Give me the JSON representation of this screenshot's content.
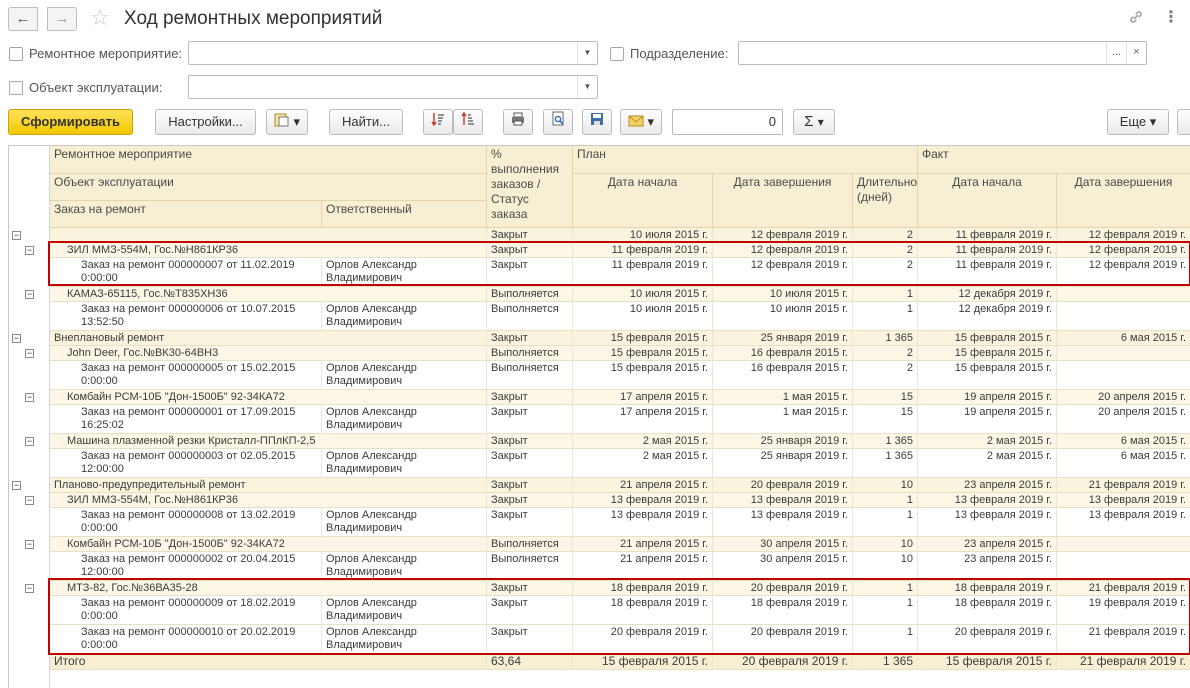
{
  "window": {
    "title": "Ход ремонтных мероприятий",
    "back_icon": "←",
    "forward_icon": "→",
    "star_icon": "☆",
    "link_icon": "🔗",
    "more_icon": "⋮"
  },
  "filters": {
    "repair_label": "Ремонтное мероприятие:",
    "repair_value": "",
    "department_label": "Подразделение:",
    "department_value": "",
    "object_label": "Объект эксплуатации:",
    "object_value": "",
    "select_btn": "...",
    "clear_btn": "×"
  },
  "toolbar": {
    "generate": "Сформировать",
    "settings": "Настройки...",
    "find": "Найти...",
    "number_value": "0",
    "sum_icon": "Σ",
    "more": "Еще",
    "dropdown": "▾"
  },
  "headers": {
    "repair": "Ремонтное мероприятие",
    "object": "Объект эксплуатации",
    "order": "Заказ на ремонт",
    "responsible": "Ответственный",
    "percent": "% выполнения заказов / Статус заказа",
    "plan": "План",
    "plan_start": "Дата начала",
    "plan_end": "Дата завершения",
    "duration": "Длительность (дней)",
    "fact": "Факт",
    "fact_start": "Дата начала",
    "fact_end": "Дата завершения"
  },
  "rows": [
    {
      "level": 0,
      "name": "",
      "status": "Закрыт",
      "plan_start": "10 июля 2015 г.",
      "plan_end": "12 февраля 2019 г.",
      "duration": "2",
      "fact_start": "11 февраля 2019 г.",
      "fact_end": "12 февраля 2019 г."
    },
    {
      "level": 1,
      "name": "ЗИЛ ММЗ-554М, Гос.№Н861КР36",
      "status": "Закрыт",
      "plan_start": "11 февраля 2019 г.",
      "plan_end": "12 февраля 2019 г.",
      "duration": "2",
      "fact_start": "11 февраля 2019 г.",
      "fact_end": "12 февраля 2019 г."
    },
    {
      "level": 2,
      "name": "Заказ на ремонт 000000007 от 11.02.2019 0:00:00",
      "responsible": "Орлов Александр Владимирович",
      "status": "Закрыт",
      "plan_start": "11 февраля 2019 г.",
      "plan_end": "12 февраля 2019 г.",
      "duration": "2",
      "fact_start": "11 февраля 2019 г.",
      "fact_end": "12 февраля 2019 г."
    },
    {
      "level": 1,
      "name": "КАМАЗ-65115, Гос.№Т835ХН36",
      "status": "Выполняется",
      "plan_start": "10 июля 2015 г.",
      "plan_end": "10 июля 2015 г.",
      "duration": "1",
      "fact_start": "12 декабря 2019 г.",
      "fact_end": ""
    },
    {
      "level": 2,
      "name": "Заказ на ремонт 000000006 от 10.07.2015 13:52:50",
      "responsible": "Орлов Александр Владимирович",
      "status": "Выполняется",
      "plan_start": "10 июля 2015 г.",
      "plan_end": "10 июля 2015 г.",
      "duration": "1",
      "fact_start": "12 декабря 2019 г.",
      "fact_end": ""
    },
    {
      "level": 0,
      "name": "Внеплановый ремонт",
      "status": "Закрыт",
      "plan_start": "15 февраля 2015 г.",
      "plan_end": "25 января 2019 г.",
      "duration": "1 365",
      "fact_start": "15 февраля 2015 г.",
      "fact_end": "6 мая 2015 г."
    },
    {
      "level": 1,
      "name": "John Deer, Гос.№ВК30-64ВН3",
      "status": "Выполняется",
      "plan_start": "15 февраля 2015 г.",
      "plan_end": "16 февраля 2015 г.",
      "duration": "2",
      "fact_start": "15 февраля 2015 г.",
      "fact_end": ""
    },
    {
      "level": 2,
      "name": "Заказ на ремонт 000000005 от 15.02.2015 0:00:00",
      "responsible": "Орлов Александр Владимирович",
      "status": "Выполняется",
      "plan_start": "15 февраля 2015 г.",
      "plan_end": "16 февраля 2015 г.",
      "duration": "2",
      "fact_start": "15 февраля 2015 г.",
      "fact_end": ""
    },
    {
      "level": 1,
      "name": "Комбайн РСМ-10Б \"Дон-1500Б\" 92-34КА72",
      "status": "Закрыт",
      "plan_start": "17 апреля 2015 г.",
      "plan_end": "1 мая 2015 г.",
      "duration": "15",
      "fact_start": "19 апреля 2015 г.",
      "fact_end": "20 апреля 2015 г."
    },
    {
      "level": 2,
      "name": "Заказ на ремонт 000000001 от 17.09.2015 16:25:02",
      "responsible": "Орлов Александр Владимирович",
      "status": "Закрыт",
      "plan_start": "17 апреля 2015 г.",
      "plan_end": "1 мая 2015 г.",
      "duration": "15",
      "fact_start": "19 апреля 2015 г.",
      "fact_end": "20 апреля 2015 г."
    },
    {
      "level": 1,
      "name": "Машина плазменной резки Кристалл-ППлКП-2,5",
      "status": "Закрыт",
      "plan_start": "2 мая 2015 г.",
      "plan_end": "25 января 2019 г.",
      "duration": "1 365",
      "fact_start": "2 мая 2015 г.",
      "fact_end": "6 мая 2015 г."
    },
    {
      "level": 2,
      "name": "Заказ на ремонт 000000003 от 02.05.2015 12:00:00",
      "responsible": "Орлов Александр Владимирович",
      "status": "Закрыт",
      "plan_start": "2 мая 2015 г.",
      "plan_end": "25 января 2019 г.",
      "duration": "1 365",
      "fact_start": "2 мая 2015 г.",
      "fact_end": "6 мая 2015 г."
    },
    {
      "level": 0,
      "name": "Планово-предупредительный ремонт",
      "status": "Закрыт",
      "plan_start": "21 апреля 2015 г.",
      "plan_end": "20 февраля 2019 г.",
      "duration": "10",
      "fact_start": "23 апреля 2015 г.",
      "fact_end": "21 февраля 2019 г."
    },
    {
      "level": 1,
      "name": "ЗИЛ ММЗ-554М, Гос.№Н861КР36",
      "status": "Закрыт",
      "plan_start": "13 февраля 2019 г.",
      "plan_end": "13 февраля 2019 г.",
      "duration": "1",
      "fact_start": "13 февраля 2019 г.",
      "fact_end": "13 февраля 2019 г."
    },
    {
      "level": 2,
      "name": "Заказ на ремонт 000000008 от 13.02.2019 0:00:00",
      "responsible": "Орлов Александр Владимирович",
      "status": "Закрыт",
      "plan_start": "13 февраля 2019 г.",
      "plan_end": "13 февраля 2019 г.",
      "duration": "1",
      "fact_start": "13 февраля 2019 г.",
      "fact_end": "13 февраля 2019 г."
    },
    {
      "level": 1,
      "name": "Комбайн РСМ-10Б \"Дон-1500Б\" 92-34КА72",
      "status": "Выполняется",
      "plan_start": "21 апреля 2015 г.",
      "plan_end": "30 апреля 2015 г.",
      "duration": "10",
      "fact_start": "23 апреля 2015 г.",
      "fact_end": ""
    },
    {
      "level": 2,
      "name": "Заказ на ремонт 000000002 от 20.04.2015 12:00:00",
      "responsible": "Орлов Александр Владимирович",
      "status": "Выполняется",
      "plan_start": "21 апреля 2015 г.",
      "plan_end": "30 апреля 2015 г.",
      "duration": "10",
      "fact_start": "23 апреля 2015 г.",
      "fact_end": ""
    },
    {
      "level": 1,
      "name": "МТЗ-82, Гос.№36ВА35-28",
      "status": "Закрыт",
      "plan_start": "18 февраля 2019 г.",
      "plan_end": "20 февраля 2019 г.",
      "duration": "1",
      "fact_start": "18 февраля 2019 г.",
      "fact_end": "21 февраля 2019 г."
    },
    {
      "level": 2,
      "name": "Заказ на ремонт 000000009 от 18.02.2019 0:00:00",
      "responsible": "Орлов Александр Владимирович",
      "status": "Закрыт",
      "plan_start": "18 февраля 2019 г.",
      "plan_end": "18 февраля 2019 г.",
      "duration": "1",
      "fact_start": "18 февраля 2019 г.",
      "fact_end": "19 февраля 2019 г."
    },
    {
      "level": 2,
      "name": "Заказ на ремонт 000000010 от 20.02.2019 0:00:00",
      "responsible": "Орлов Александр Владимирович",
      "status": "Закрыт",
      "plan_start": "20 февраля 2019 г.",
      "plan_end": "20 февраля 2019 г.",
      "duration": "1",
      "fact_start": "20 февраля 2019 г.",
      "fact_end": "21 февраля 2019 г."
    }
  ],
  "total": {
    "label": "Итого",
    "percent": "63,64",
    "plan_start": "15 февраля 2015 г.",
    "plan_end": "20 февраля 2019 г.",
    "duration": "1 365",
    "fact_start": "15 февраля 2015 г.",
    "fact_end": "21 февраля 2019 г."
  },
  "colors": {
    "accent": "#f2c700",
    "header_bg": "#f7efd4",
    "highlight": "#c00000"
  }
}
